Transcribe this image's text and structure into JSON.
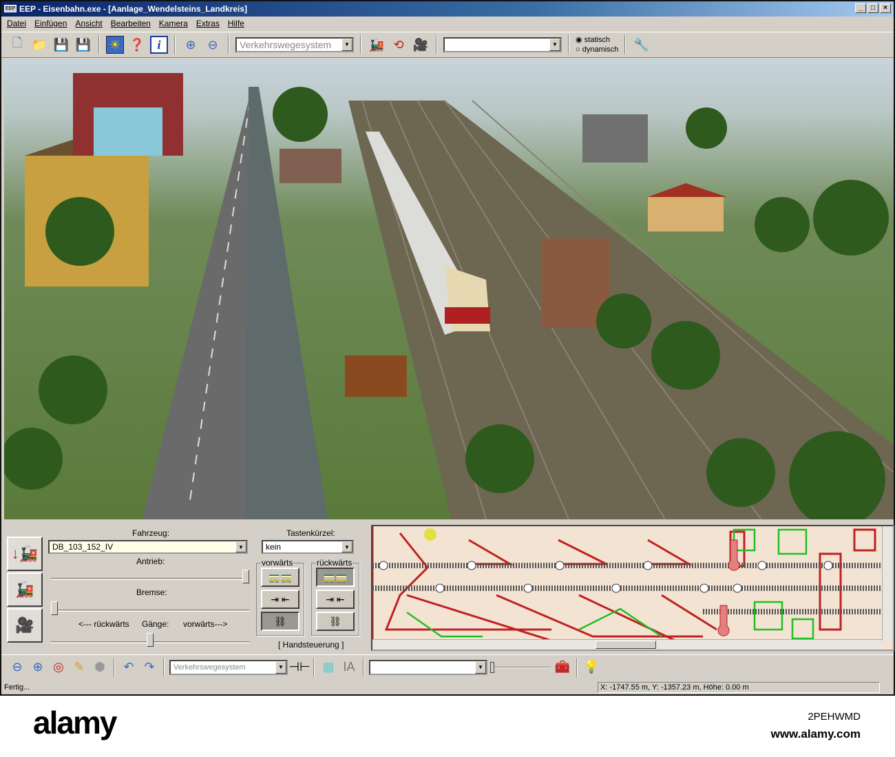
{
  "window": {
    "title": "EEP - Eisenbahn.exe - [Aanlage_Wendelsteins_Landkreis]",
    "app_icon": "EEP",
    "min": "_",
    "max": "□",
    "close": "×"
  },
  "menu": [
    "Datei",
    "Einfügen",
    "Ansicht",
    "Bearbeiten",
    "Kamera",
    "Extras",
    "Hilfe"
  ],
  "toolbar": {
    "layer_combo": "Verkehrswegesystem",
    "combo2": "",
    "radio_static": "statisch",
    "radio_dynamic": "dynamisch",
    "selected_mode": "statisch"
  },
  "panel": {
    "vehicle_label": "Fahrzeug:",
    "vehicle_value": "DB_103_152_IV",
    "shortcut_label": "Tastenkürzel:",
    "shortcut_value": "kein",
    "drive_label": "Antrieb:",
    "brake_label": "Bremse:",
    "backward_label": "<--- rückwärts",
    "gears_label": "Gänge:",
    "forward_label": "vorwärts--->",
    "forward_group": "vorwärts",
    "backward_group": "rückwärts",
    "manual_label": "[ Handsteuerung ]",
    "drive_value": 1.0,
    "brake_value": 0.0,
    "gear_value": 0.5
  },
  "toolbar2": {
    "layer_combo": "Verkehrswegesystem",
    "combo2": ""
  },
  "status": {
    "left": "Fertig...",
    "coords": "X: -1747.55 m, Y: -1357.23 m, Höhe: 0.00 m"
  },
  "watermark": {
    "brand": "alamy",
    "id": "2PEHWMD",
    "url": "www.alamy.com"
  }
}
